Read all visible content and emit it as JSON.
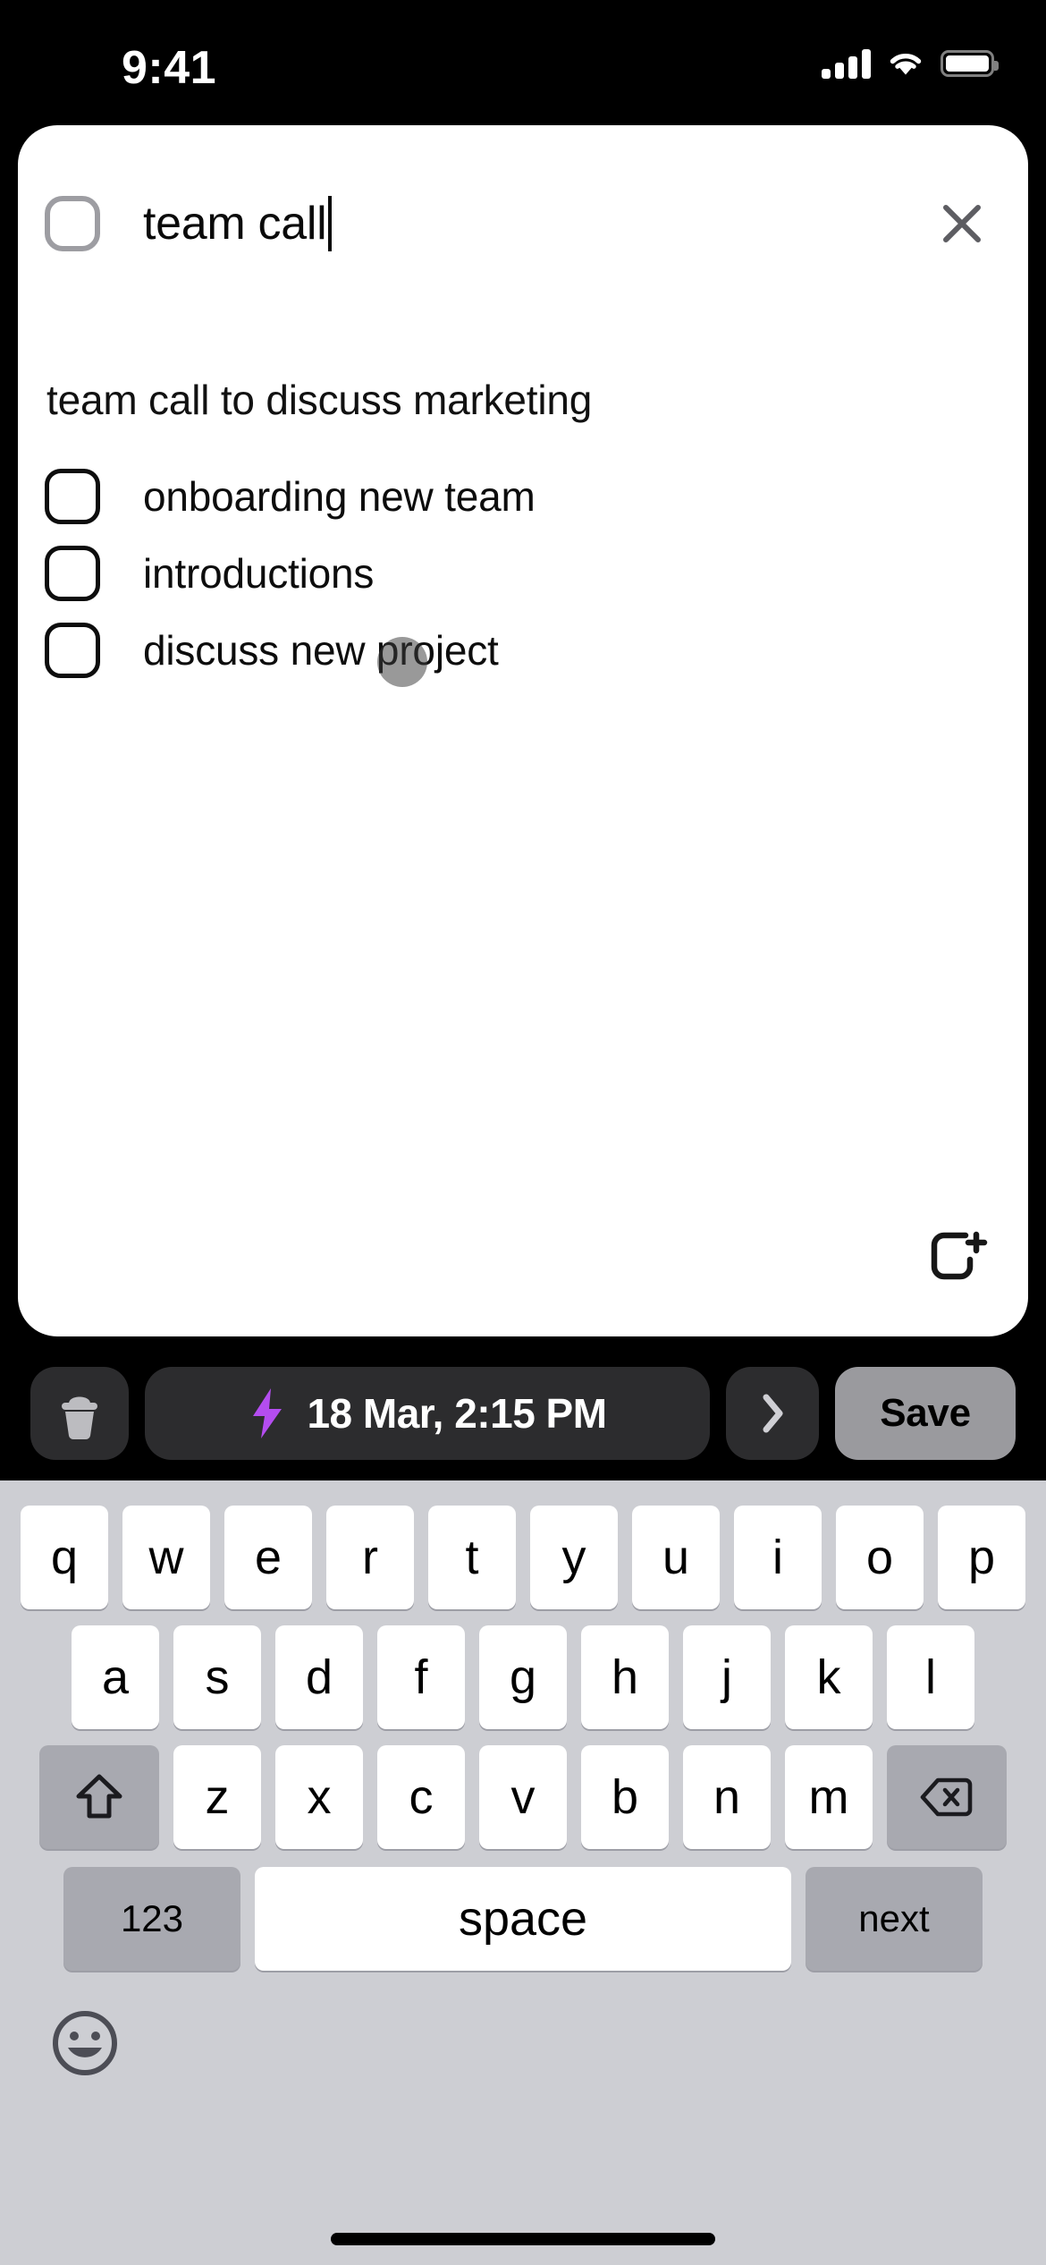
{
  "status_bar": {
    "time": "9:41",
    "signal_icon": "cellular-signal-icon",
    "wifi_icon": "wifi-icon",
    "battery_icon": "battery-full-icon"
  },
  "note_card": {
    "title_checkbox": {
      "icon": "checkbox-unchecked-icon",
      "checked": false
    },
    "title_value": "team call",
    "title_placeholder": "Title",
    "cursor_visible": true,
    "close_icon": "close-x-icon",
    "subtitle": "team call to discuss marketing",
    "subtitle_placeholder": "Notes",
    "checklist": [
      {
        "label": "onboarding new team",
        "checked": false,
        "icon": "checkbox-unchecked-icon"
      },
      {
        "label": "introductions",
        "checked": false,
        "icon": "checkbox-unchecked-icon"
      },
      {
        "label": "discuss new project",
        "checked": false,
        "icon": "checkbox-unchecked-icon"
      }
    ],
    "add_checklist_icon": "add-checklist-item-icon",
    "touch_indicator": {
      "visible": true,
      "color": "#3c3c3c"
    }
  },
  "toolbar": {
    "delete_icon": "trash-icon",
    "reminder_bolt_icon": "lightning-bolt-icon",
    "reminder_bolt_color": "#b44df0",
    "reminder_datetime": "18 Mar, 2:15 PM",
    "more_icon": "chevron-right-icon",
    "save_label": "Save",
    "save_bg_color": "#9a9a9e",
    "button_bg_color": "#2c2c2e"
  },
  "keyboard": {
    "row1": [
      "q",
      "w",
      "e",
      "r",
      "t",
      "y",
      "u",
      "i",
      "o",
      "p"
    ],
    "row2": [
      "a",
      "s",
      "d",
      "f",
      "g",
      "h",
      "j",
      "k",
      "l"
    ],
    "row3": [
      "z",
      "x",
      "c",
      "v",
      "b",
      "n",
      "m"
    ],
    "shift_icon": "shift-arrow-up-icon",
    "backspace_icon": "backspace-delete-icon",
    "numbers_label": "123",
    "space_label": "space",
    "return_label": "next",
    "emoji_icon": "emoji-smiley-icon",
    "background_color": "#cdced3",
    "key_color": "#ffffff",
    "modifier_key_color": "#a8a9b0"
  },
  "home_indicator": {
    "icon": "home-indicator-bar"
  }
}
